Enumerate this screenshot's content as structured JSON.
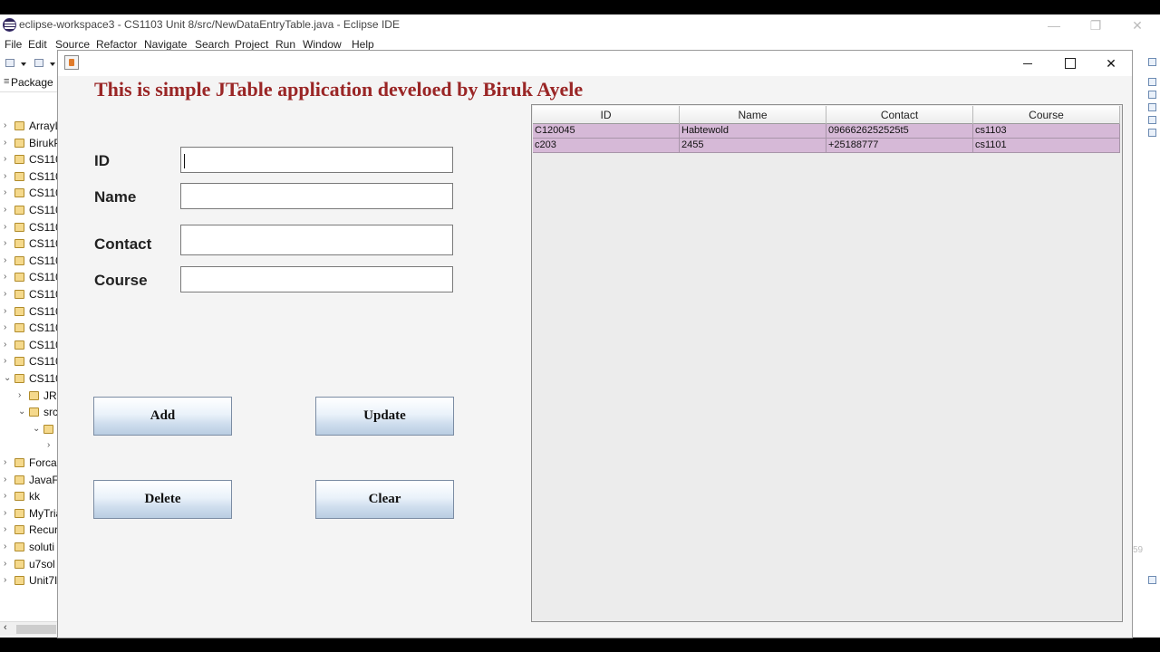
{
  "eclipse": {
    "title": "eclipse-workspace3 - CS1103 Unit 8/src/NewDataEntryTable.java - Eclipse IDE",
    "menu": [
      "File",
      "Edit",
      "Source",
      "Refactor",
      "Navigate",
      "Search",
      "Project",
      "Run",
      "Window",
      "Help"
    ],
    "package_panel_label": "Package",
    "tree": [
      {
        "arrow": ">",
        "label": "ArrayL"
      },
      {
        "arrow": ">",
        "label": "BirukP"
      },
      {
        "arrow": ">",
        "label": "CS110"
      },
      {
        "arrow": ">",
        "label": "CS110"
      },
      {
        "arrow": ">",
        "label": "CS110"
      },
      {
        "arrow": ">",
        "label": "CS110"
      },
      {
        "arrow": ">",
        "label": "CS110"
      },
      {
        "arrow": ">",
        "label": "CS110"
      },
      {
        "arrow": ">",
        "label": "CS110"
      },
      {
        "arrow": ">",
        "label": "CS110"
      },
      {
        "arrow": ">",
        "label": "CS110"
      },
      {
        "arrow": ">",
        "label": "CS110"
      },
      {
        "arrow": ">",
        "label": "CS110"
      },
      {
        "arrow": ">",
        "label": "CS110"
      },
      {
        "arrow": ">",
        "label": "CS110"
      },
      {
        "arrow": "v",
        "label": "CS110"
      },
      {
        "arrow": ">",
        "label": "JRE"
      },
      {
        "arrow": "v",
        "label": "src"
      },
      {
        "arrow": "v",
        "label": ""
      },
      {
        "arrow": ">",
        "label": ""
      },
      {
        "arrow": ">",
        "label": "Forcas"
      },
      {
        "arrow": ">",
        "label": "JavaFX"
      },
      {
        "arrow": ">",
        "label": "kk"
      },
      {
        "arrow": ">",
        "label": "MyTria"
      },
      {
        "arrow": ">",
        "label": "Recur"
      },
      {
        "arrow": ">",
        "label": "soluti"
      },
      {
        "arrow": ">",
        "label": "u7sol"
      },
      {
        "arrow": ">",
        "label": "Unit7I"
      }
    ],
    "right_edge_text": "59"
  },
  "app": {
    "heading": "This is simple JTable application develoed by Biruk Ayele",
    "fields": [
      {
        "label": "ID",
        "value": ""
      },
      {
        "label": "Name",
        "value": ""
      },
      {
        "label": "Contact",
        "value": ""
      },
      {
        "label": "Course",
        "value": ""
      }
    ],
    "buttons": {
      "add": "Add",
      "update": "Update",
      "delete": "Delete",
      "clear": "Clear"
    },
    "table": {
      "columns": [
        "ID",
        "Name",
        "Contact",
        "Course"
      ],
      "rows": [
        [
          "C120045",
          "Habtewold",
          "0966626252525t5",
          "cs1103"
        ],
        [
          "c203",
          "2455",
          "+25188777",
          "cs1101"
        ]
      ]
    }
  }
}
